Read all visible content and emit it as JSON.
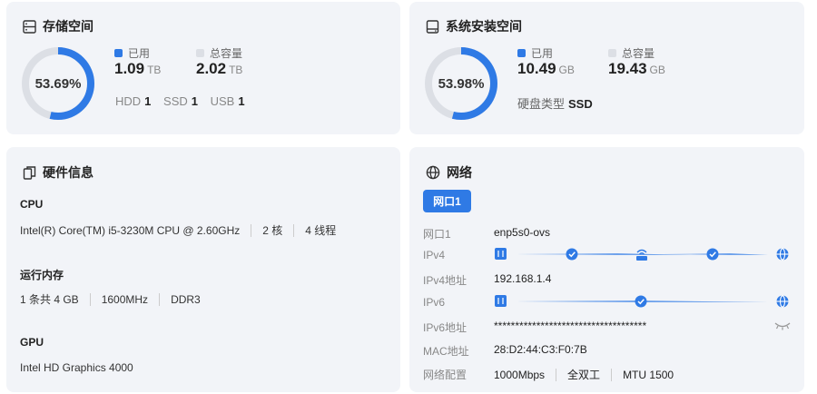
{
  "storage": {
    "title": "存储空间",
    "percent": "53.69%",
    "percent_value": 0.5369,
    "used_label": "已用",
    "used_value": "1.09",
    "used_unit": "TB",
    "total_label": "总容量",
    "total_value": "2.02",
    "total_unit": "TB",
    "disks": [
      {
        "label": "HDD",
        "count": "1"
      },
      {
        "label": "SSD",
        "count": "1"
      },
      {
        "label": "USB",
        "count": "1"
      }
    ]
  },
  "system": {
    "title": "系统安装空间",
    "percent": "53.98%",
    "percent_value": 0.5398,
    "used_label": "已用",
    "used_value": "10.49",
    "used_unit": "GB",
    "total_label": "总容量",
    "total_value": "19.43",
    "total_unit": "GB",
    "disk_type_label": "硬盘类型",
    "disk_type_value": "SSD"
  },
  "hardware": {
    "title": "硬件信息",
    "cpu_label": "CPU",
    "cpu_model": "Intel(R) Core(TM) i5-3230M CPU @ 2.60GHz",
    "cpu_cores": "2 核",
    "cpu_threads": "4 线程",
    "mem_label": "运行内存",
    "mem_slots": "1 条共 4 GB",
    "mem_freq": "1600MHz",
    "mem_type": "DDR3",
    "gpu_label": "GPU",
    "gpu_model": "Intel HD Graphics 4000"
  },
  "network": {
    "title": "网络",
    "tab": "网口1",
    "rows": {
      "port_label": "网口1",
      "port_value": "enp5s0-ovs",
      "ipv4_label": "IPv4",
      "ipv4_addr_label": "IPv4地址",
      "ipv4_addr_value": "192.168.1.4",
      "ipv6_label": "IPv6",
      "ipv6_addr_label": "IPv6地址",
      "ipv6_addr_value": "************************************",
      "mac_label": "MAC地址",
      "mac_value": "28:D2:44:C3:F0:7B",
      "config_label": "网络配置",
      "config_speed": "1000Mbps",
      "config_duplex": "全双工",
      "config_mtu": "MTU 1500"
    }
  },
  "colors": {
    "accent": "#2f7ae5",
    "track": "#dcdfe5",
    "card_bg": "#f2f4f8"
  }
}
